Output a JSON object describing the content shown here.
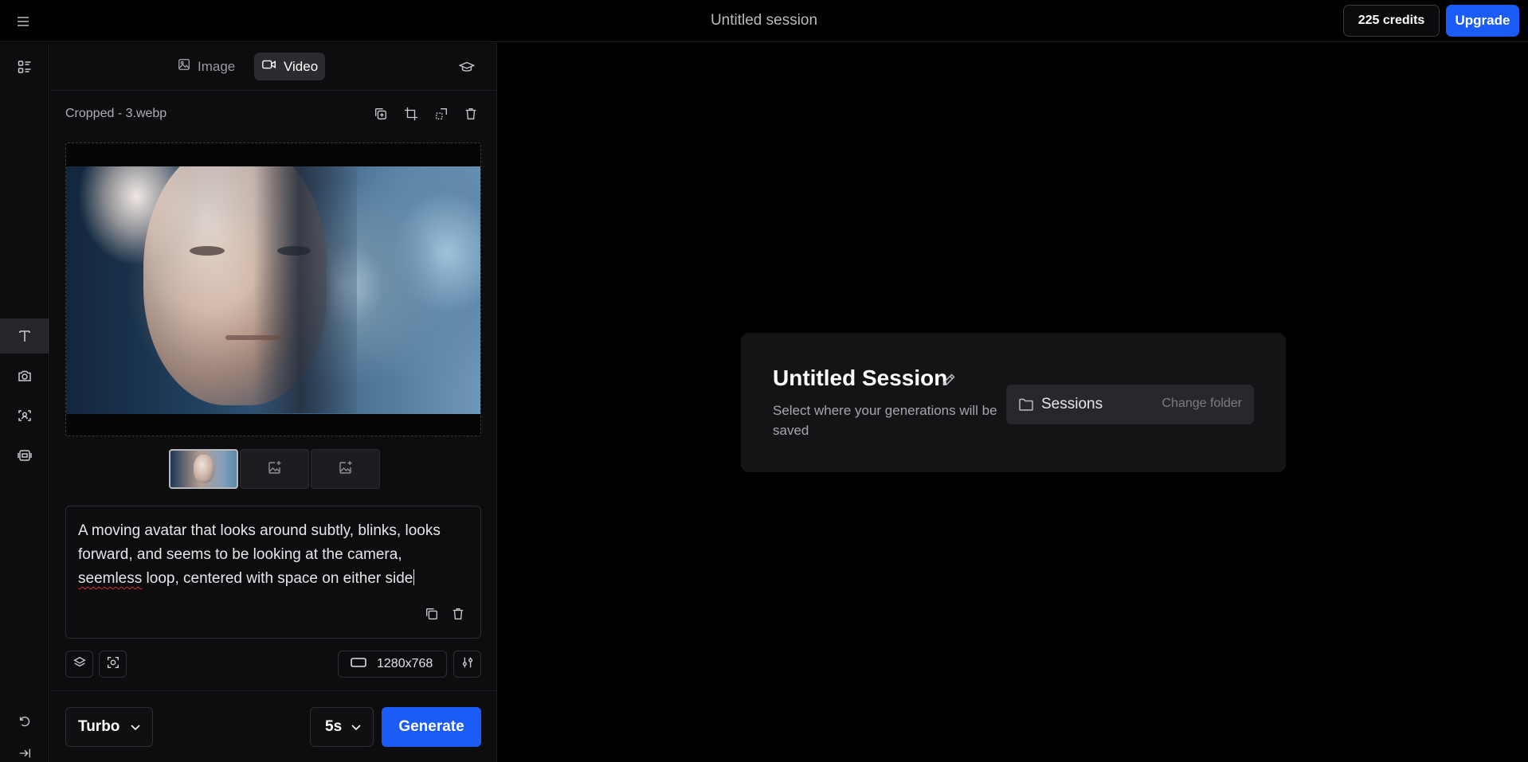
{
  "topbar": {
    "title": "Untitled session",
    "credits": "225 credits",
    "upgrade": "Upgrade"
  },
  "mode_tabs": [
    {
      "label": "Image",
      "active": false
    },
    {
      "label": "Video",
      "active": true
    }
  ],
  "file": {
    "name": "Cropped - 3.webp"
  },
  "prompt": {
    "line1": "A moving avatar that looks around subtly, blinks, looks forward, and seems to be looking at the camera,",
    "misspelled": "seemless",
    "rest": " loop, centered with space on either side"
  },
  "controls": {
    "resolution": "1280x768"
  },
  "bottom": {
    "model": "Turbo",
    "duration": "5s",
    "generate": "Generate"
  },
  "session": {
    "title": "Untitled Session",
    "description": "Select where your generations will be saved",
    "folder": "Sessions",
    "change_folder": "Change folder"
  },
  "colors": {
    "accent": "#1a5cf5",
    "background": "#000000",
    "panel": "#0d0d0f"
  },
  "icons": [
    "hamburger-icon",
    "list-icon",
    "image-icon",
    "video-icon",
    "graduation-cap-icon",
    "duplicate-icon",
    "crop-icon",
    "mask-icon",
    "trash-icon",
    "text-icon",
    "camera-icon",
    "face-scan-icon",
    "frames-icon",
    "undo-icon",
    "collapse-icon",
    "layers-icon",
    "focus-icon",
    "aspect-icon",
    "settings-sliders-icon",
    "chevron-down-icon",
    "pencil-icon",
    "folder-icon",
    "add-image-icon"
  ]
}
